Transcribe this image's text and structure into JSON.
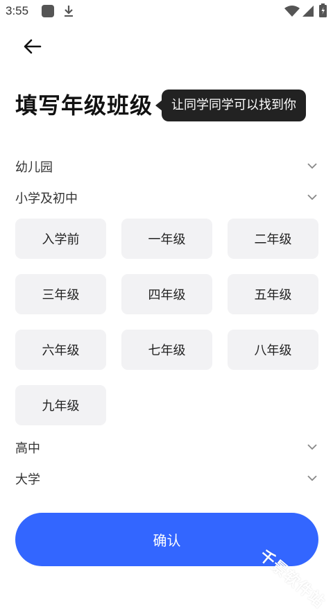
{
  "status_bar": {
    "time": "3:55",
    "icons": [
      "app-icon",
      "download-icon",
      "wifi-icon",
      "signal-icon",
      "battery-icon"
    ]
  },
  "header": {
    "back_icon": "arrow-left-icon"
  },
  "title": "填写年级班级",
  "tooltip": "让同学同学可以找到你",
  "sections": {
    "kindergarten": "幼儿园",
    "primary_middle": "小学及初中",
    "high_school": "高中",
    "university": "大学"
  },
  "grades": [
    "入学前",
    "一年级",
    "二年级",
    "三年级",
    "四年级",
    "五年级",
    "六年级",
    "七年级",
    "八年级",
    "九年级"
  ],
  "confirm_label": "确认",
  "watermark": "千景软件站",
  "colors": {
    "accent": "#3366ff",
    "grade_bg": "#f2f2f4",
    "tooltip_bg": "#222222"
  }
}
